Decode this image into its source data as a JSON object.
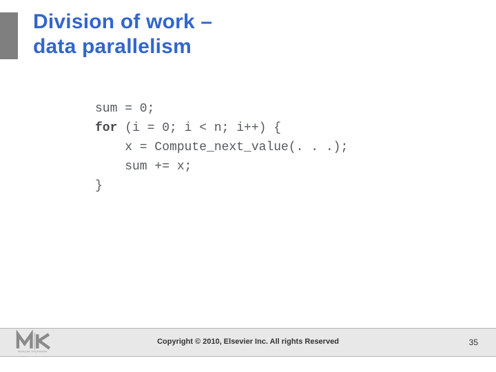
{
  "title": {
    "line1": "Division of work –",
    "line2": "data parallelism"
  },
  "code": {
    "l1a": "sum = 0;",
    "kw_for": "for",
    "l2b": " (i = 0; i < n; i++) {",
    "l3": "    x = Compute_next_value(. . .);",
    "l4": "    sum += x;",
    "l5": "}"
  },
  "footer": {
    "copyright": "Copyright © 2010, Elsevier Inc. All rights Reserved",
    "page": "35",
    "publisher": "MORGAN KAUFMANN"
  }
}
